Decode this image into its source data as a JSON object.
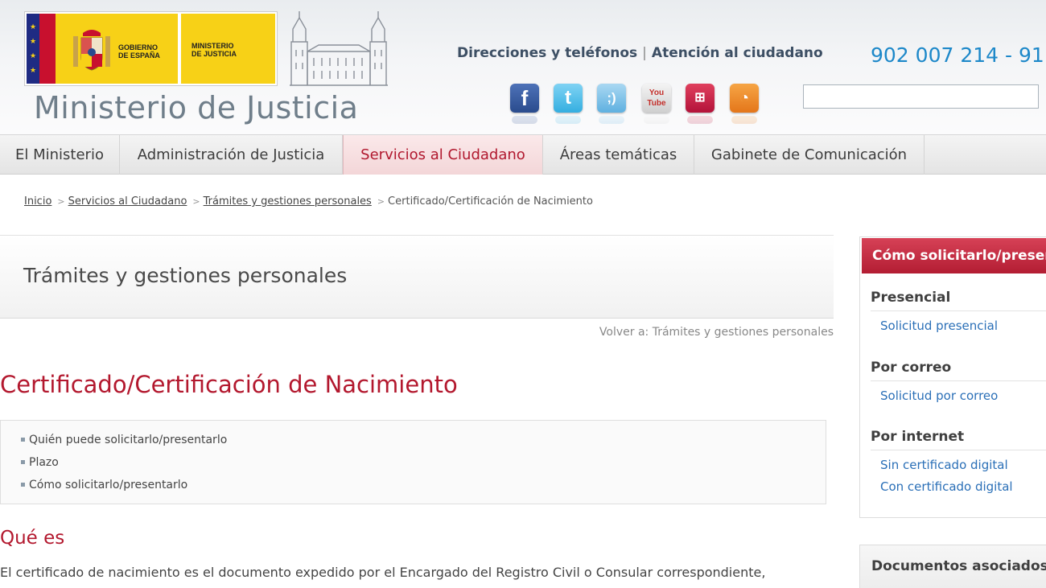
{
  "header": {
    "logo_gobierno": "GOBIERNO\nDE ESPAÑA",
    "logo_ministerio": "MINISTERIO\nDE JUSTICIA",
    "site_title": "Ministerio de Justicia",
    "top_links": [
      "Direcciones y teléfonos",
      "Atención al ciudadano"
    ],
    "top_links_sep": "|",
    "phone": "902 007 214 - 91",
    "search_value": "",
    "social_icons": [
      "facebook-icon",
      "twitter-icon",
      "tuenti-icon",
      "youtube-icon",
      "sitemap-icon",
      "rss-icon"
    ]
  },
  "nav": {
    "items": [
      "El Ministerio",
      "Administración de Justicia",
      "Servicios al Ciudadano",
      "Áreas temáticas",
      "Gabinete de Comunicación"
    ],
    "active": "Servicios al Ciudadano"
  },
  "breadcrumb": {
    "items": [
      "Inicio",
      "Servicios al Ciudadano",
      "Trámites y gestiones personales",
      "Certificado/Certificación de Nacimiento"
    ],
    "separator": ">"
  },
  "section": {
    "title": "Trámites y gestiones personales",
    "volver": "Volver a: Trámites y gestiones personales"
  },
  "main": {
    "title": "Certificado/Certificación de Nacimiento",
    "toc": [
      "Quién puede solicitarlo/presentarlo",
      "Plazo",
      "Cómo solicitarlo/presentarlo"
    ],
    "que_es_heading": "Qué es",
    "paragraph": "El certificado de nacimiento es el documento expedido por el Encargado del Registro Civil o Consular correspondiente,"
  },
  "sidebar": {
    "header": "Cómo solicitarlo/presentarlo",
    "sections": [
      {
        "title": "Presencial",
        "links": [
          "Solicitud presencial"
        ]
      },
      {
        "title": "Por correo",
        "links": [
          "Solicitud por correo"
        ]
      },
      {
        "title": "Por internet",
        "links": [
          "Sin certificado digital",
          "Con certificado digital"
        ]
      }
    ],
    "docs_header": "Documentos asociados"
  },
  "colors": {
    "accent_red": "#b3182e",
    "link_blue": "#2a6fb7",
    "phone_blue": "#1d88c9",
    "flag_yellow": "#f7d117"
  }
}
